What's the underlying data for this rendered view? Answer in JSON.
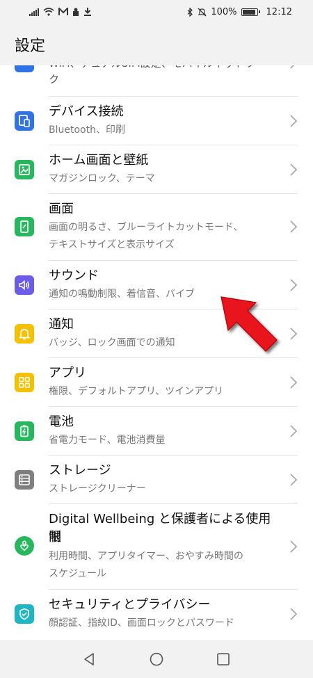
{
  "status_bar": {
    "battery_percent": "100%",
    "time": "12:12",
    "left_icons": [
      "signal-icon",
      "wifi-icon",
      "mail-icon",
      "lock-icon",
      "download-icon"
    ],
    "right_icons": [
      "bluetooth-icon",
      "mute-icon",
      "battery-icon"
    ]
  },
  "header": {
    "title": "設定"
  },
  "partial_item": {
    "title": "WiFi、デュアルSIM設定、モバイルネットワー",
    "subtitle": "ク"
  },
  "items": [
    {
      "id": "device-connection",
      "title": "デバイス接続",
      "subtitle": "Bluetooth、印刷",
      "icon": "device-connection-icon",
      "color": "#2f73e6"
    },
    {
      "id": "home-wallpaper",
      "title": "ホーム画面と壁紙",
      "subtitle": "マガジンロック、テーマ",
      "icon": "wallpaper-icon",
      "color": "#27b85d"
    },
    {
      "id": "display",
      "title": "画面",
      "subtitle": "画面の明るさ、ブルーライトカットモード、",
      "subtitle2": "テキストサイズと表示サイズ",
      "icon": "display-icon",
      "color": "#27b85d"
    },
    {
      "id": "sound",
      "title": "サウンド",
      "subtitle": "通知の鳴動制限、着信音、バイブ",
      "icon": "sound-icon",
      "color": "#6c5ce7"
    },
    {
      "id": "notifications",
      "title": "通知",
      "subtitle": "バッジ、ロック画面での通知",
      "icon": "bell-icon",
      "color": "#f5c000"
    },
    {
      "id": "apps",
      "title": "アプリ",
      "subtitle": "権限、デフォルトアプリ、ツインアプリ",
      "icon": "apps-grid-icon",
      "color": "#f5c000"
    },
    {
      "id": "battery",
      "title": "電池",
      "subtitle": "省電力モード、電池消費量",
      "icon": "battery-charge-icon",
      "color": "#27b85d"
    },
    {
      "id": "storage",
      "title": "ストレージ",
      "subtitle": "ストレージクリーナー",
      "icon": "storage-icon",
      "color": "#7f7f7f"
    },
    {
      "id": "wellbeing",
      "title": "Digital Wellbeing と保護者による使用制",
      "title2": "限",
      "subtitle": "利用時間、アプリタイマー、おやすみ時間の",
      "subtitle2": "スケジュール",
      "icon": "wellbeing-icon",
      "color": "#27b85d"
    },
    {
      "id": "security",
      "title": "セキュリティとプライバシー",
      "subtitle": "顔認証、指紋ID、画面ロックとパスワード",
      "icon": "shield-icon",
      "color": "#1fb6c4"
    }
  ],
  "annotation": {
    "arrow_color": "#e8141b",
    "target": "sound"
  }
}
